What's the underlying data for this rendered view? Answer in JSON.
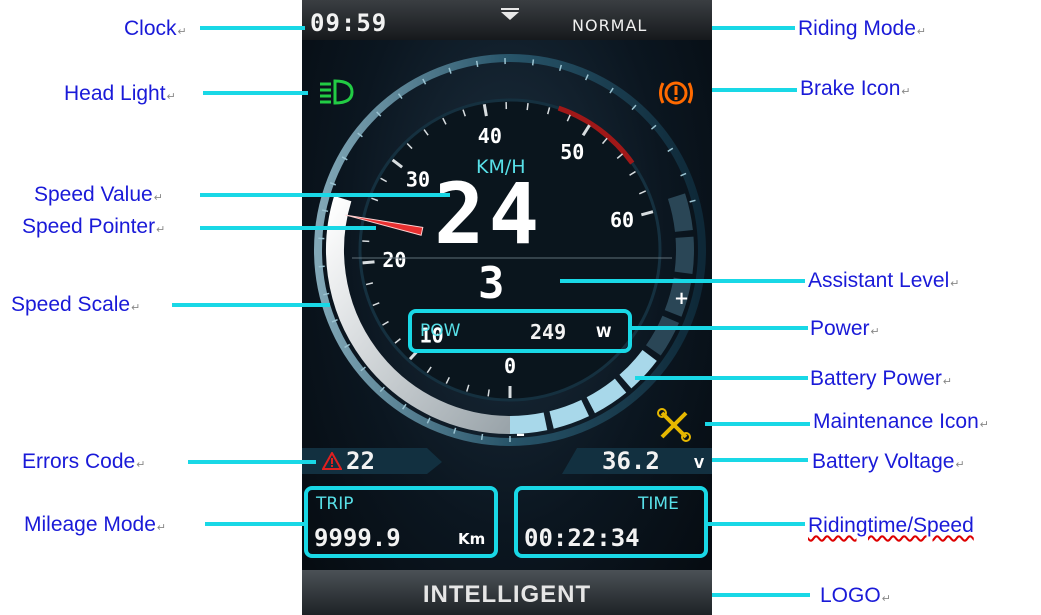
{
  "display": {
    "clock": "09:59",
    "riding_mode": "NORMAL",
    "speed_unit": "KM/H",
    "speed": "24",
    "assist_level": "3",
    "power_label": "POW",
    "power_value": "249",
    "power_unit": "W",
    "error_code": "22",
    "battery_voltage": "36.2",
    "voltage_unit": "V",
    "trip_label": "TRIP",
    "trip_value": "9999.9",
    "trip_unit": "Km",
    "time_label": "TIME",
    "time_value": "00:22:34",
    "logo": "INTELLIGENT",
    "battery_plus": "+",
    "battery_minus": "–",
    "scale_ticks": [
      "0",
      "10",
      "20",
      "30",
      "40",
      "50",
      "60"
    ],
    "scale_max": 60,
    "speed_fraction": 0.4,
    "battery_fraction": 0.55,
    "colors": {
      "callout_text": "#1a1ad8",
      "leader_line": "#19d8e6",
      "headlight": "#22cc44",
      "brake": "#ff6a00",
      "maintenance": "#e6b800",
      "error_icon": "#e02020",
      "pointer": "#e83030"
    },
    "icons": [
      "headlight-icon",
      "brake-icon",
      "maintenance-icon",
      "warning-icon",
      "menu-down-icon"
    ]
  },
  "callouts": {
    "clock": "Clock",
    "head_light": "Head Light",
    "speed_value": "Speed Value",
    "speed_pointer": "Speed Pointer",
    "speed_scale": "Speed Scale",
    "errors_code": "Errors Code",
    "mileage_mode": "Mileage Mode",
    "riding_mode": "Riding Mode",
    "brake_icon": "Brake Icon",
    "assistant_level": "Assistant Level",
    "power": "Power",
    "battery_power": "Battery Power",
    "maintenance_icon": "Maintenance Icon",
    "battery_voltage": "Battery Voltage",
    "ridingtime_speed": "Ridingtime/Speed",
    "logo": "LOGO",
    "return_mark": "↵"
  }
}
